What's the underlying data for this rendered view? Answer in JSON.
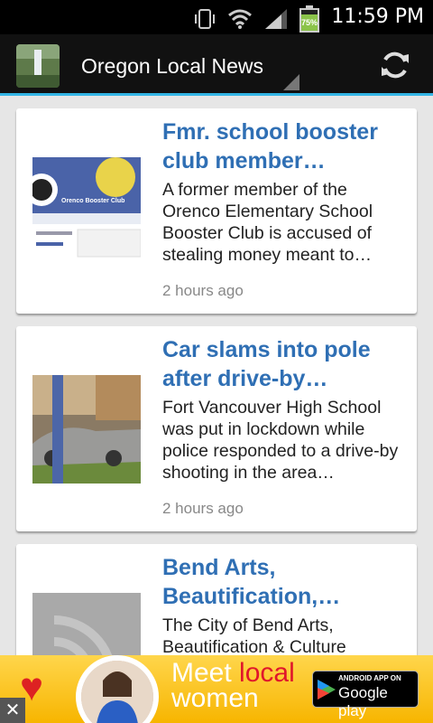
{
  "status_bar": {
    "time": "11:59 PM",
    "battery_level": "75%",
    "icons": [
      "vibrate-icon",
      "wifi-icon",
      "signal-icon",
      "battery-icon"
    ]
  },
  "action_bar": {
    "title": "Oregon Local News",
    "accent": "#33b5e5"
  },
  "articles": [
    {
      "headline": "Fmr. school booster club member…",
      "summary": "A former member of the Orenco Elementary School Booster Club is accused of stealing money meant to…",
      "time": "2 hours ago",
      "thumb_text": "Orenco Booster Club"
    },
    {
      "headline": "Car slams into pole after drive-by…",
      "summary": "Fort Vancouver High School was put in lockdown while police responded to a drive-by shooting in the area…",
      "time": "2 hours ago"
    },
    {
      "headline": "Bend Arts, Beautification,…",
      "summary": "The City of Bend Arts, Beautification & Culture",
      "time": ""
    }
  ],
  "ad": {
    "close": "✕",
    "meet": "Meet",
    "local": "local",
    "women": "women",
    "gp_small": "ANDROID APP ON",
    "gp_big": "Google play"
  }
}
